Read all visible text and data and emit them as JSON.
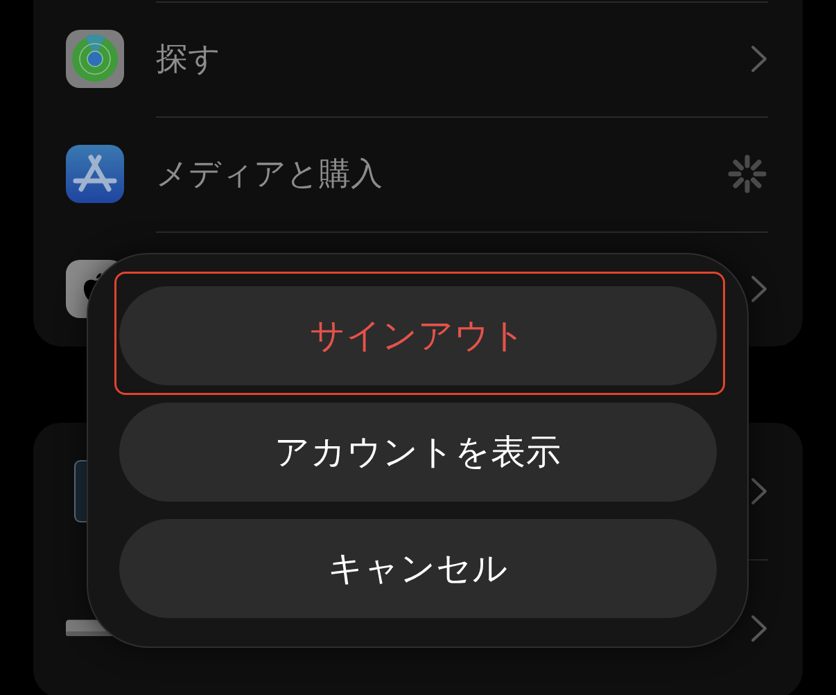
{
  "groups": [
    {
      "rows": [
        {
          "kind": "find",
          "label": "探す",
          "accessory": {
            "kind": "chevron"
          }
        },
        {
          "kind": "media",
          "label": "メディアと購入",
          "accessory": {
            "kind": "spinner"
          }
        },
        {
          "kind": "apple",
          "accessory": {
            "kind": "chevron"
          }
        }
      ]
    },
    {
      "rows": [
        {
          "kind": "device",
          "accessory": {
            "kind": "chevron"
          }
        },
        {
          "kind": "mac",
          "accessory": {
            "kind": "chevron"
          }
        }
      ]
    }
  ],
  "action_sheet": {
    "buttons": [
      {
        "label": "サインアウト",
        "destructive": true,
        "highlighted": true
      },
      {
        "label": "アカウントを表示",
        "destructive": false,
        "highlighted": false
      },
      {
        "label": "キャンセル",
        "destructive": false,
        "highlighted": false
      }
    ]
  }
}
